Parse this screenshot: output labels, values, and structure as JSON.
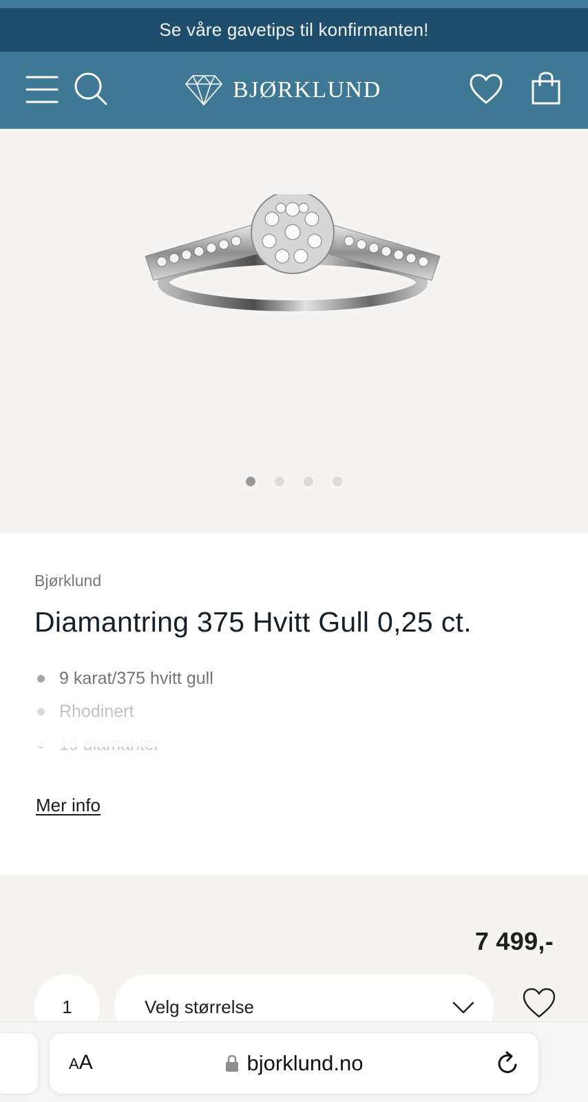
{
  "promo": {
    "text": "Se våre gavetips til konfirmanten!"
  },
  "header": {
    "logo_text": "BJØRKLUND"
  },
  "gallery": {
    "image_count": 4,
    "active_index": 0
  },
  "product": {
    "brand": "Bjørklund",
    "title": "Diamantring 375 Hvitt Gull 0,25 ct.",
    "features": [
      "9 karat/375 hvitt gull",
      "Rhodinert",
      "19 diamanter"
    ],
    "more_info": "Mer info"
  },
  "purchase": {
    "price": "7 499,-",
    "quantity": "1",
    "size_placeholder": "Velg størrelse"
  },
  "browser": {
    "text_size_label_small": "A",
    "text_size_label_large": "A",
    "url": "bjorklund.no"
  },
  "colors": {
    "brand_blue": "#3f7895",
    "promo_dark": "#1f4e6c",
    "gallery_bg": "#f5f4f2",
    "buy_bg": "#f5f4f0"
  }
}
